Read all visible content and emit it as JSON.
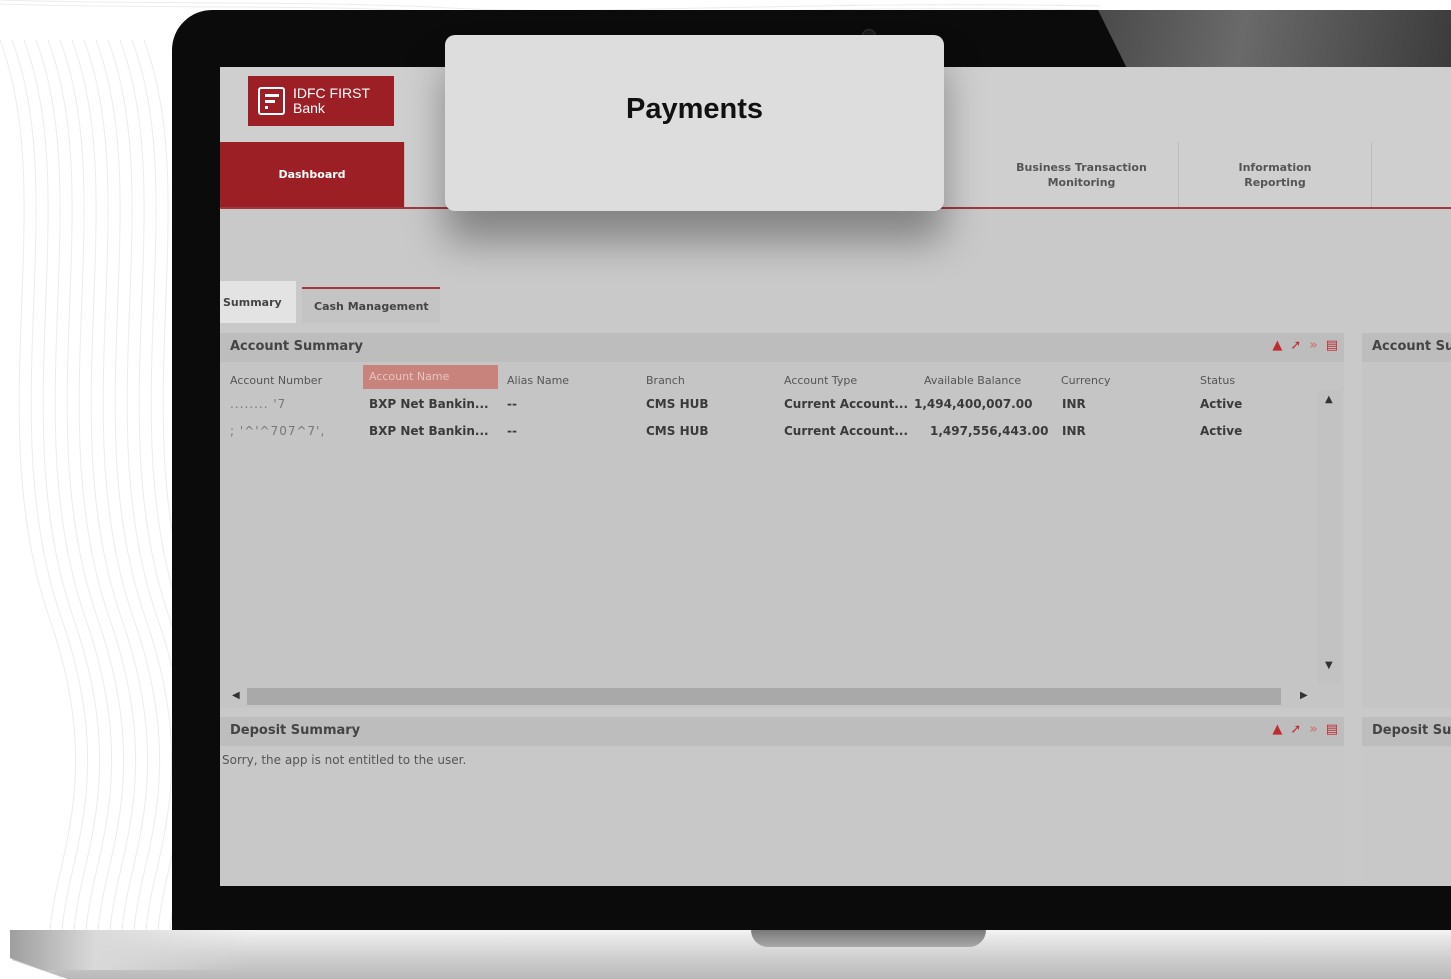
{
  "logo": {
    "brand": "IDFC FIRST",
    "sub": "Bank"
  },
  "nav": {
    "dashboard": "Dashboard",
    "business_transaction": "Business Transaction Monitoring",
    "information_reporting": "Information Reporting"
  },
  "sub_tabs": {
    "summary": "Summary",
    "cash_management": "Cash Management"
  },
  "account_summary": {
    "title": "Account Summary",
    "columns": [
      "Account Number",
      "Account Name",
      "Alias Name",
      "Branch",
      "Account Type",
      "Available Balance",
      "Currency",
      "Status"
    ],
    "rows": [
      {
        "account_number": "........ '7",
        "account_name": "BXP Net Bankin...",
        "alias": "--",
        "branch": "CMS HUB",
        "type": "Current Account...",
        "balance": "1,494,400,007.00",
        "currency": "INR",
        "status": "Active"
      },
      {
        "account_number": "; '^'^707^7', ",
        "account_name": "BXP Net Bankin...",
        "alias": "--",
        "branch": "CMS HUB",
        "type": "Current Account...",
        "balance": "1,497,556,443.00",
        "currency": "INR",
        "status": "Active"
      }
    ]
  },
  "account_summary_right": {
    "title": "Account Su"
  },
  "deposit_summary": {
    "title": "Deposit Summary",
    "message": "Sorry, the app is not entitled to the user."
  },
  "deposit_summary_right": {
    "title": "Deposit Su"
  },
  "popup": {
    "title": "Payments"
  },
  "colors": {
    "brand_red": "#9c1f26",
    "tool_red": "#c22a31"
  },
  "icons": [
    "collapse-icon",
    "wrench-icon",
    "expand-icon",
    "minimize-icon"
  ]
}
